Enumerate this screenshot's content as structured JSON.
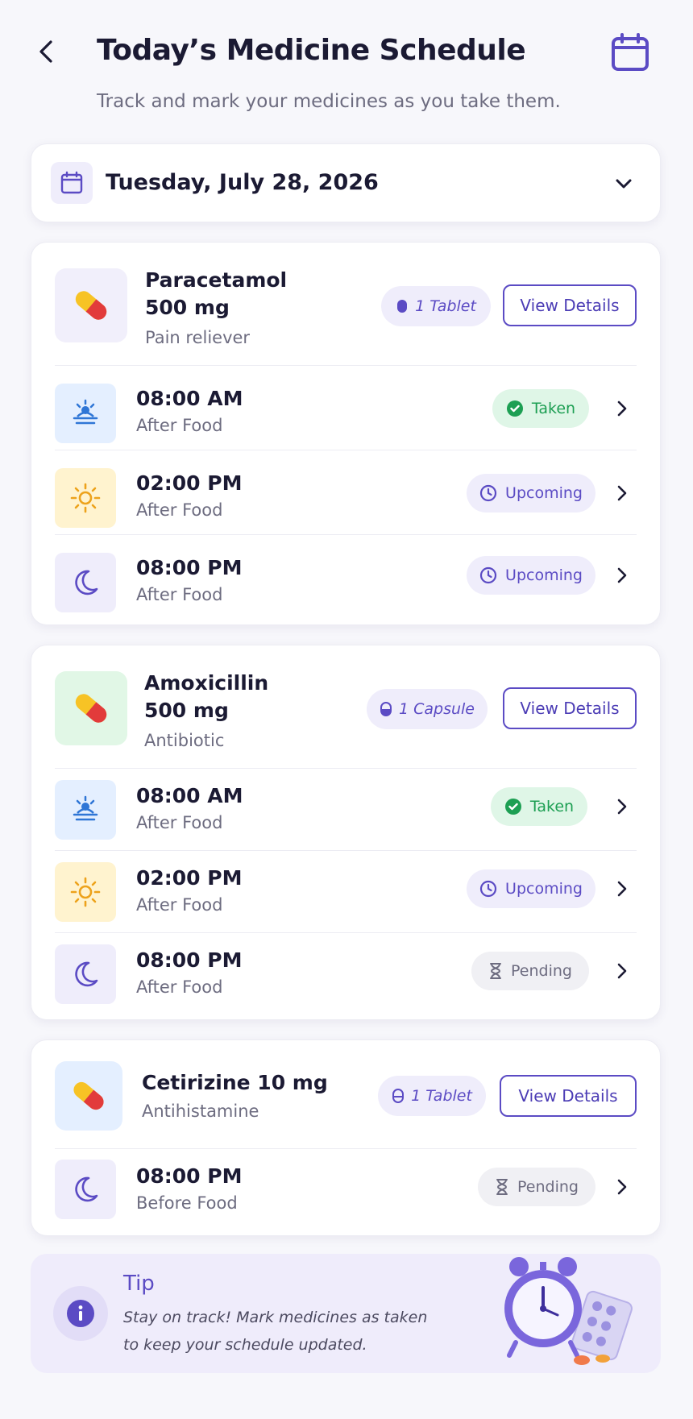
{
  "header": {
    "title": "Today’s Medicine Schedule",
    "subtitle": "Track and mark your medicines as you take them."
  },
  "date_selector": {
    "value": "Tuesday, July 28, 2026"
  },
  "colors": {
    "accent": "#5b4bc4",
    "taken": "#1d9f53",
    "pending": "#6d6c80"
  },
  "medicines": [
    {
      "name_line1": "Paracetamol",
      "name_line2": "500 mg",
      "category": "Pain reliever",
      "dose": "1 Tablet",
      "details_label": "View Details",
      "doses": [
        {
          "time": "08:00 AM",
          "food": "After Food",
          "status": "Taken",
          "icon": "sunrise-icon"
        },
        {
          "time": "02:00 PM",
          "food": "After Food",
          "status": "Upcoming",
          "icon": "sun-icon"
        },
        {
          "time": "08:00 PM",
          "food": "After Food",
          "status": "Upcoming",
          "icon": "moon-icon"
        }
      ]
    },
    {
      "name_line1": "Amoxicillin",
      "name_line2": "500 mg",
      "category": "Antibiotic",
      "dose": "1 Capsule",
      "details_label": "View Details",
      "doses": [
        {
          "time": "08:00 AM",
          "food": "After Food",
          "status": "Taken",
          "icon": "sunrise-icon"
        },
        {
          "time": "02:00 PM",
          "food": "After Food",
          "status": "Upcoming",
          "icon": "sun-icon"
        },
        {
          "time": "08:00 PM",
          "food": "After Food",
          "status": "Pending",
          "icon": "moon-icon"
        }
      ]
    },
    {
      "name_line1": "Cetirizine 10 mg",
      "category": "Antihistamine",
      "dose": "1 Tablet",
      "details_label": "View Details",
      "doses": [
        {
          "time": "08:00 PM",
          "food": "Before Food",
          "status": "Pending",
          "icon": "moon-icon"
        }
      ]
    }
  ],
  "tip": {
    "title": "Tip",
    "body": "Stay on track! Mark medicines as taken to keep your schedule updated."
  }
}
